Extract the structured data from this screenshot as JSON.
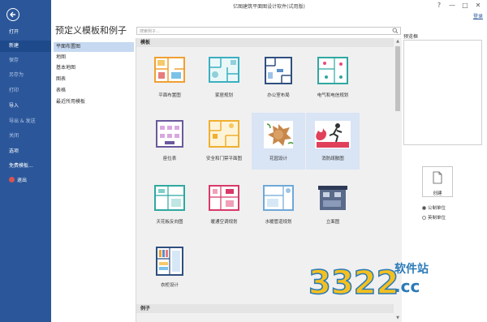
{
  "window": {
    "title": "亿图建筑平面图设计软件(试用版)",
    "controls": [
      "?",
      "—",
      "□",
      "✕"
    ],
    "login": "登录"
  },
  "sidebar": {
    "items": [
      {
        "label": "打开",
        "dim": false
      },
      {
        "label": "新建",
        "dim": false,
        "active": true
      },
      {
        "label": "保存",
        "dim": true
      },
      {
        "label": "另存为",
        "dim": true
      },
      {
        "label": "打印",
        "dim": true
      },
      {
        "label": "导入",
        "dim": false
      },
      {
        "label": "导出 & 发送",
        "dim": true
      },
      {
        "label": "关闭",
        "dim": true
      },
      {
        "label": "选项",
        "dim": false
      },
      {
        "label": "免费模板...",
        "dim": false
      },
      {
        "label": "退出",
        "dim": false
      }
    ]
  },
  "main": {
    "title": "预定义模板和例子",
    "search_placeholder": "搜索例子..."
  },
  "categories": [
    "平面布置图",
    "地图",
    "基本地图",
    "图表",
    "表格",
    "最近所用模板"
  ],
  "gallery": {
    "header": "模板",
    "footer": "例子",
    "scroll_up": "▲",
    "scroll_down": "▼",
    "templates": [
      {
        "label": "平面布置图",
        "icon": "floor-plan-icon"
      },
      {
        "label": "家居规划",
        "icon": "home-plan-icon"
      },
      {
        "label": "办公室布局",
        "icon": "office-layout-icon"
      },
      {
        "label": "电气和电信规划",
        "icon": "electrical-plan-icon"
      },
      {
        "label": "座位表",
        "icon": "seating-chart-icon"
      },
      {
        "label": "安全和门禁平面图",
        "icon": "security-plan-icon"
      },
      {
        "label": "花园设计",
        "icon": "garden-design-icon",
        "selected": true
      },
      {
        "label": "消防疏散图",
        "icon": "fire-escape-icon",
        "selected": true
      },
      {
        "label": "天花板反向图",
        "icon": "ceiling-plan-icon"
      },
      {
        "label": "暖通空调规划",
        "icon": "hvac-plan-icon"
      },
      {
        "label": "水暖管道规划",
        "icon": "plumbing-plan-icon"
      },
      {
        "label": "立面图",
        "icon": "elevation-icon"
      },
      {
        "label": "衣柜设计",
        "icon": "wardrobe-design-icon"
      }
    ]
  },
  "right_panel": {
    "preview_label": "预览框",
    "create_label": "创建",
    "units": [
      {
        "label": "公制单位",
        "checked": true
      },
      {
        "label": "英制单位",
        "checked": false
      }
    ]
  },
  "watermark": {
    "text_main": "3322",
    "text_cn": "软件站",
    "text_domain": ".cc"
  },
  "colors": {
    "sidebar": "#2b579a",
    "selected_tile": "#d9e4f5",
    "selected_category": "#c6d9f1"
  }
}
